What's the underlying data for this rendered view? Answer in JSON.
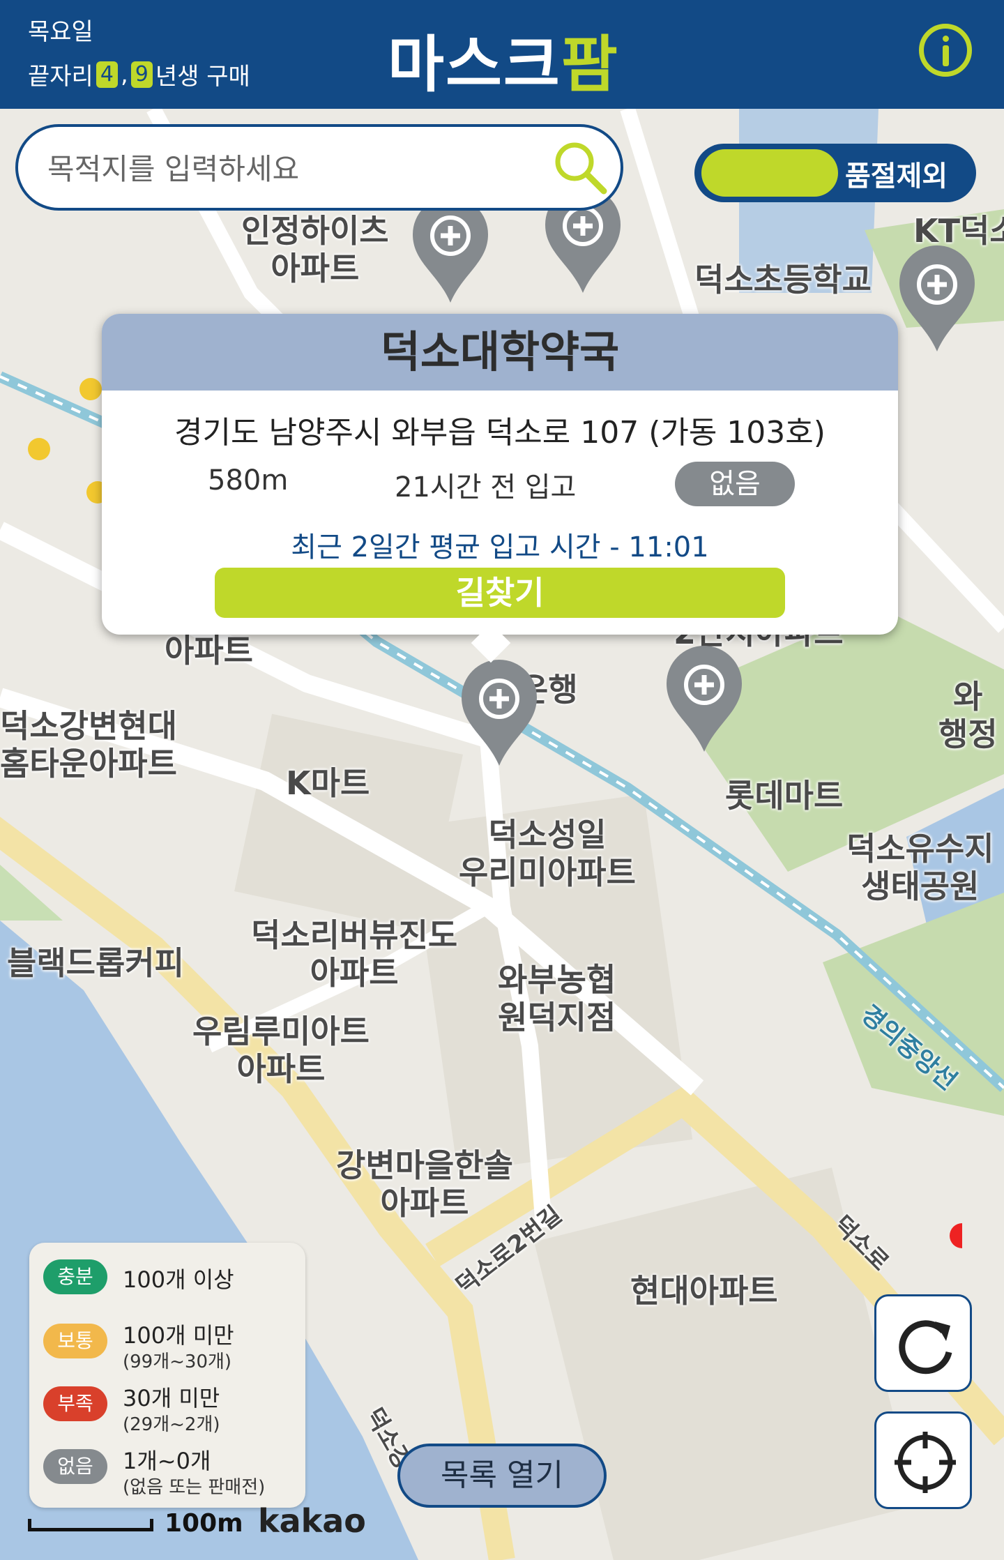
{
  "header": {
    "day": "목요일",
    "rule_prefix": "끝자리",
    "digit1": "4",
    "separator": ",",
    "digit2": "9",
    "rule_suffix": "년생 구매",
    "logo_main": "마스크",
    "logo_accent": "팜"
  },
  "search": {
    "placeholder": "목적지를 입력하세요"
  },
  "toggle": {
    "label": "품절제외",
    "state": "on"
  },
  "popup": {
    "title": "덕소대학약국",
    "address": "경기도 남양주시 와부읍 덕소로 107 (가동 103호)",
    "distance": "580m",
    "stocked": "21시간 전 입고",
    "status": "없음",
    "average": "최근 2일간 평균 입고 시간 - 11:01",
    "button": "길찾기"
  },
  "map_labels": {
    "l1": "인정하이츠\n아파트",
    "l2": "덕소초등학교",
    "l3": "KT덕소",
    "l4": "아파트",
    "l5": "덕소강변현대\n홈타운아파트",
    "l6": "K마트",
    "l7": "롯데마트",
    "l8": "덕소성일\n우리미아파트",
    "l9": "덕소유수지\n생태공원",
    "l10": "블랙드롭커피",
    "l11": "덕소리버뷰진도\n아파트",
    "l12": "와부농협\n원덕지점",
    "l13": "우림루미아트\n아파트",
    "l14": "강변마을한솔\n아파트",
    "l15": "현대아파트",
    "l16": "2단지아파트",
    "l17": "은행",
    "l18": "와\n행정",
    "l19": "덕소로",
    "l20": "덕소로2번길",
    "l21": "경의중앙선",
    "l22": "덕소강"
  },
  "legend": {
    "items": [
      {
        "badge": "충분",
        "main": "100개 이상",
        "sub": "",
        "color": "#1e9e6a"
      },
      {
        "badge": "보통",
        "main": "100개 미만",
        "sub": "(99개~30개)",
        "color": "#f2b84b"
      },
      {
        "badge": "부족",
        "main": "30개 미만",
        "sub": "(29개~2개)",
        "color": "#d9402b"
      },
      {
        "badge": "없음",
        "main": "1개~0개",
        "sub": "(없음 또는 판매전)",
        "color": "#858a8e"
      }
    ]
  },
  "controls": {
    "open_list": "목록 열기",
    "refresh_icon": "refresh-icon",
    "locate_icon": "crosshair-icon"
  },
  "footer": {
    "scale": "100m",
    "attribution": "kakao"
  },
  "colors": {
    "brand": "#124a86",
    "accent": "#bfd82a",
    "marker": "#858a8e"
  }
}
